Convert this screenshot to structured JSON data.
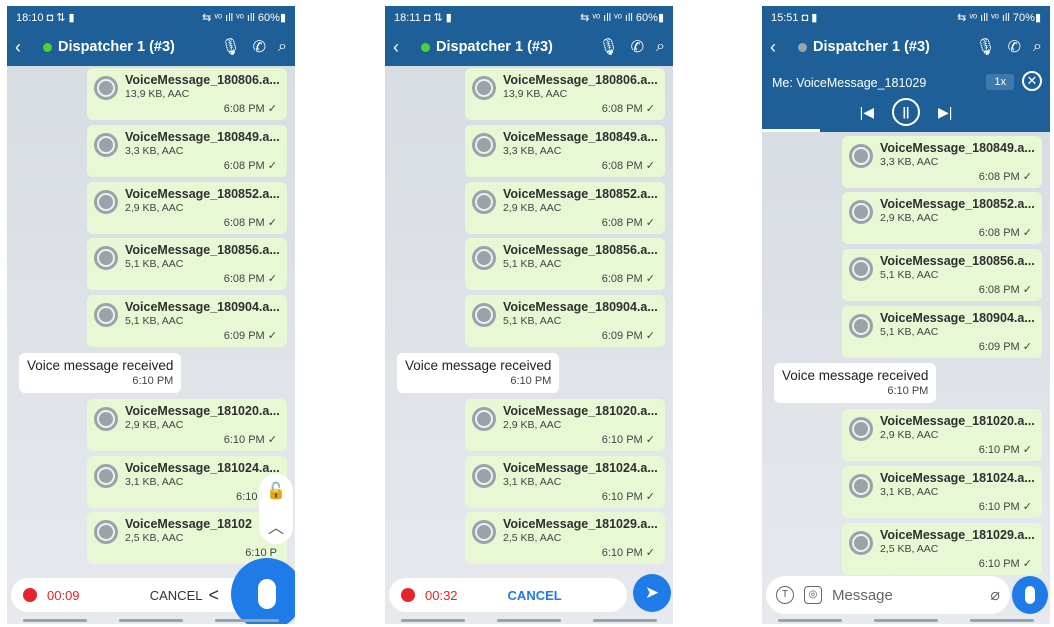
{
  "colors": {
    "header": "#1d5f96",
    "bubble": "#e8f7d4",
    "accent": "#1f7be8",
    "recording": "#e5252b",
    "online": "#4cd137",
    "offline": "#9aa4ad"
  },
  "phones": [
    {
      "status": {
        "time": "18:10 ◘ ⇅ ▮",
        "right": "⇆ ᵛᵒ ıll ᵛᵒ ıll 60%▮"
      },
      "title": "Dispatcher 1 (#3)",
      "messages": [
        {
          "name": "VoiceMessage_180806.a...",
          "meta": "13,9 KB, AAC",
          "time": "6:08 PM ✓"
        },
        {
          "name": "VoiceMessage_180849.a...",
          "meta": "3,3 KB, AAC",
          "time": "6:08 PM ✓"
        },
        {
          "name": "VoiceMessage_180852.a...",
          "meta": "2,9 KB, AAC",
          "time": "6:08 PM ✓"
        },
        {
          "name": "VoiceMessage_180856.a...",
          "meta": "5,1 KB, AAC",
          "time": "6:08 PM ✓"
        },
        {
          "name": "VoiceMessage_180904.a...",
          "meta": "5,1 KB, AAC",
          "time": "6:09 PM ✓"
        },
        {
          "name": "VoiceMessage_181020.a...",
          "meta": "2,9 KB, AAC",
          "time": "6:10 PM ✓"
        },
        {
          "name": "VoiceMessage_181024.a...",
          "meta": "3,1 KB, AAC",
          "time": "6:10 PM"
        },
        {
          "name": "VoiceMessage_18102",
          "meta": "2,5 KB, AAC",
          "time": "6:10 P"
        }
      ],
      "received": {
        "text": "Voice message received",
        "time": "6:10 PM"
      },
      "record_time": "00:09",
      "cancel": "CANCEL",
      "cancel_chevron": "<"
    },
    {
      "status": {
        "time": "18:11 ◘ ⇅ ▮",
        "right": "⇆ ᵛᵒ ıll ᵛᵒ ıll 60%▮"
      },
      "title": "Dispatcher 1 (#3)",
      "messages": [
        {
          "name": "VoiceMessage_180806.a...",
          "meta": "13,9 KB, AAC",
          "time": "6:08 PM ✓"
        },
        {
          "name": "VoiceMessage_180849.a...",
          "meta": "3,3 KB, AAC",
          "time": "6:08 PM ✓"
        },
        {
          "name": "VoiceMessage_180852.a...",
          "meta": "2,9 KB, AAC",
          "time": "6:08 PM ✓"
        },
        {
          "name": "VoiceMessage_180856.a...",
          "meta": "5,1 KB, AAC",
          "time": "6:08 PM ✓"
        },
        {
          "name": "VoiceMessage_180904.a...",
          "meta": "5,1 KB, AAC",
          "time": "6:09 PM ✓"
        },
        {
          "name": "VoiceMessage_181020.a...",
          "meta": "2,9 KB, AAC",
          "time": "6:10 PM ✓"
        },
        {
          "name": "VoiceMessage_181024.a...",
          "meta": "3,1 KB, AAC",
          "time": "6:10 PM ✓"
        },
        {
          "name": "VoiceMessage_181029.a...",
          "meta": "2,5 KB, AAC",
          "time": "6:10 PM ✓"
        }
      ],
      "received": {
        "text": "Voice message received",
        "time": "6:10 PM"
      },
      "record_time": "00:32",
      "cancel": "CANCEL"
    },
    {
      "status": {
        "time": "15:51 ◘ ▮",
        "right": "⇆ ᵛᵒ ıll ᵛᵒ ıll 70%▮"
      },
      "title": "Dispatcher 1 (#3)",
      "player": {
        "title": "Me: VoiceMessage_181029",
        "speed": "1x",
        "prev": "|◀",
        "pause": "||",
        "next": "▶|",
        "close": "✕"
      },
      "messages": [
        {
          "name": "VoiceMessage_180849.a...",
          "meta": "3,3 KB, AAC",
          "time": "6:08 PM ✓"
        },
        {
          "name": "VoiceMessage_180852.a...",
          "meta": "2,9 KB, AAC",
          "time": "6:08 PM ✓"
        },
        {
          "name": "VoiceMessage_180856.a...",
          "meta": "5,1 KB, AAC",
          "time": "6:08 PM ✓"
        },
        {
          "name": "VoiceMessage_180904.a...",
          "meta": "5,1 KB, AAC",
          "time": "6:09 PM ✓"
        },
        {
          "name": "VoiceMessage_181020.a...",
          "meta": "2,9 KB, AAC",
          "time": "6:10 PM ✓"
        },
        {
          "name": "VoiceMessage_181024.a...",
          "meta": "3,1 KB, AAC",
          "time": "6:10 PM ✓"
        },
        {
          "name": "VoiceMessage_181029.a...",
          "meta": "2,5 KB, AAC",
          "time": "6:10 PM ✓"
        }
      ],
      "received": {
        "text": "Voice message received",
        "time": "6:10 PM"
      },
      "composer_placeholder": "Message"
    }
  ]
}
